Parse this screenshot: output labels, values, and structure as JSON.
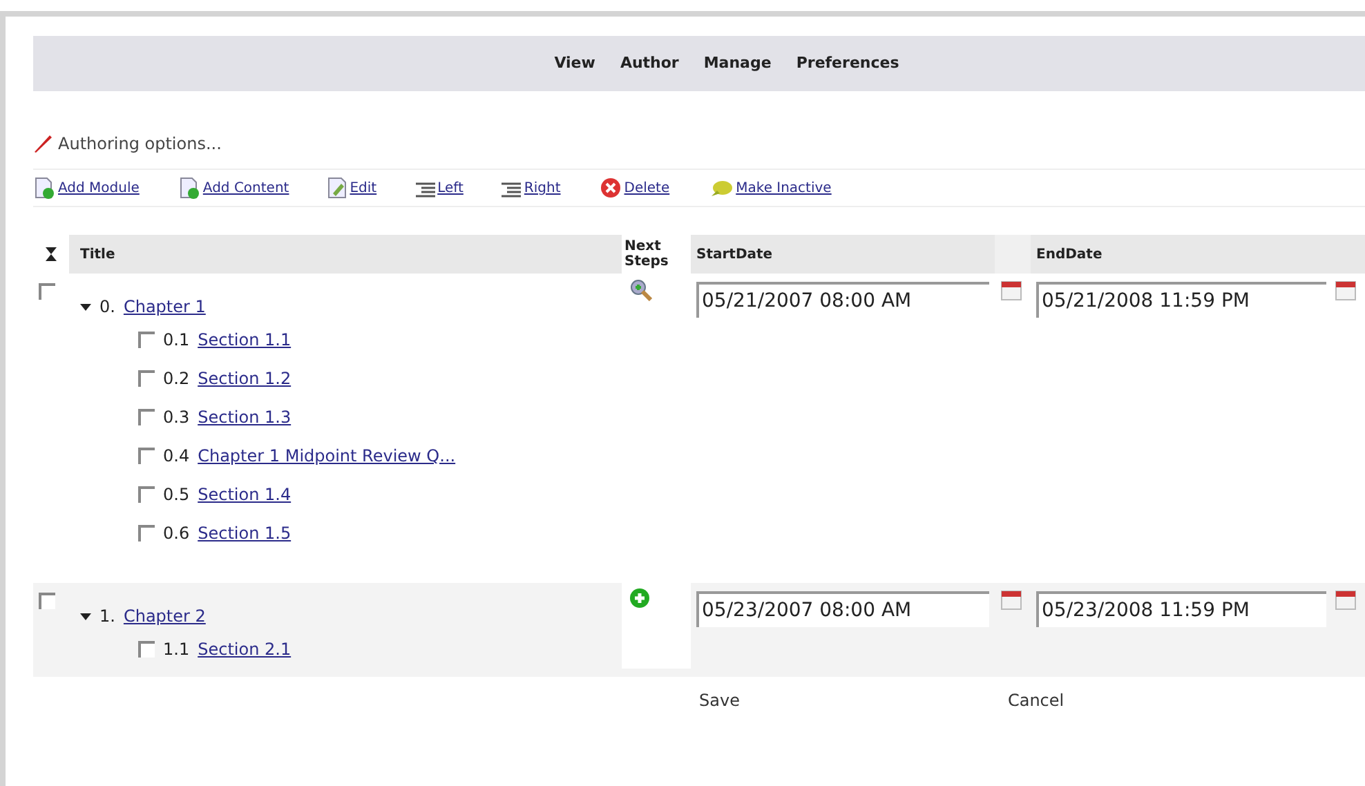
{
  "nav": [
    "View",
    "Author",
    "Manage",
    "Preferences"
  ],
  "authoring": "Authoring options...",
  "toolbar": [
    {
      "kind": "add-module",
      "label": "Add Module"
    },
    {
      "kind": "add-content",
      "label": "Add Content"
    },
    {
      "kind": "edit",
      "label": "Edit"
    },
    {
      "kind": "left",
      "label": "Left"
    },
    {
      "kind": "right",
      "label": "Right"
    },
    {
      "kind": "delete",
      "label": "Delete"
    },
    {
      "kind": "inactive",
      "label": "Make Inactive"
    }
  ],
  "table": {
    "columns": [
      "Title",
      "Next Steps",
      "StartDate",
      "EndDate"
    ],
    "rows": [
      {
        "checked": false,
        "expanded": true,
        "number": "0.",
        "title": "Chapter 1",
        "next_step": {
          "kind": "search"
        },
        "start": "05/21/2007 08:00 AM",
        "end": "05/21/2008 11:59 PM",
        "children": [
          {
            "checked": false,
            "number": "0.1",
            "title": "Section 1.1"
          },
          {
            "checked": false,
            "number": "0.2",
            "title": "Section 1.2"
          },
          {
            "checked": false,
            "number": "0.3",
            "title": "Section 1.3"
          },
          {
            "checked": false,
            "number": "0.4",
            "title": "Chapter 1 Midpoint Review Q..."
          },
          {
            "checked": false,
            "number": "0.5",
            "title": "Section 1.4"
          },
          {
            "checked": false,
            "number": "0.6",
            "title": "Section 1.5"
          }
        ]
      },
      {
        "checked": false,
        "expanded": true,
        "number": "1.",
        "title": "Chapter 2",
        "next_step": {
          "kind": "add"
        },
        "start": "05/23/2007 08:00 AM",
        "end": "05/23/2008 11:59 PM",
        "children": [
          {
            "checked": false,
            "number": "1.1",
            "title": "Section 2.1"
          }
        ]
      }
    ]
  },
  "buttons": [
    "Save",
    "Cancel"
  ]
}
